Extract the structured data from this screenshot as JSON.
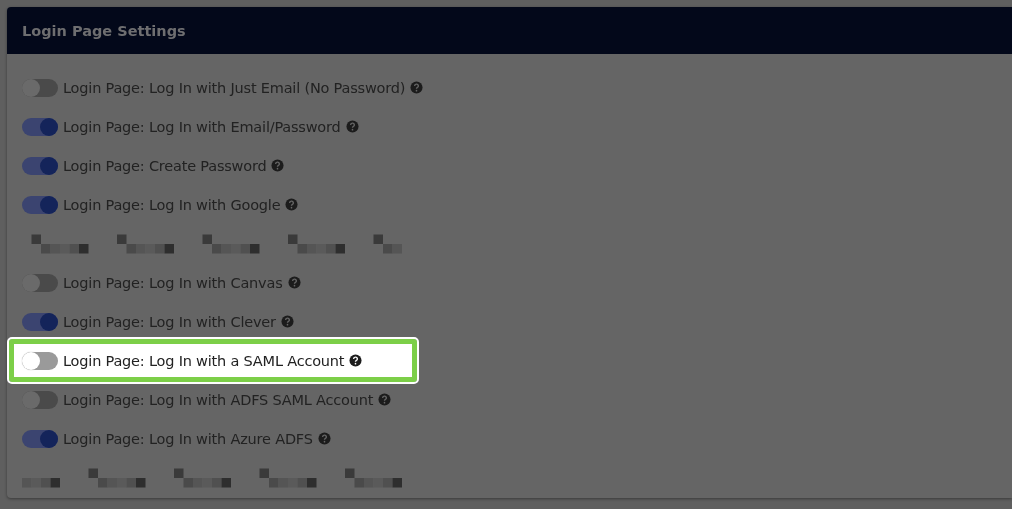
{
  "panel": {
    "title": "Login Page Settings"
  },
  "settings": [
    {
      "kind": "toggle",
      "label": "Login Page: Log In with Just Email (No Password)",
      "on": false,
      "highlighted": false
    },
    {
      "kind": "toggle",
      "label": "Login Page: Log In with Email/Password",
      "on": true,
      "highlighted": false
    },
    {
      "kind": "toggle",
      "label": "Login Page: Create Password",
      "on": true,
      "highlighted": false
    },
    {
      "kind": "toggle",
      "label": "Login Page: Log In with Google",
      "on": true,
      "highlighted": false
    },
    {
      "kind": "redacted"
    },
    {
      "kind": "toggle",
      "label": "Login Page: Log In with Canvas",
      "on": false,
      "highlighted": false
    },
    {
      "kind": "toggle",
      "label": "Login Page: Log In with Clever",
      "on": true,
      "highlighted": false
    },
    {
      "kind": "toggle",
      "label": "Login Page: Log In with a SAML Account",
      "on": false,
      "highlighted": true
    },
    {
      "kind": "toggle",
      "label": "Login Page: Log In with ADFS SAML Account",
      "on": false,
      "highlighted": false
    },
    {
      "kind": "toggle",
      "label": "Login Page: Log In with Azure ADFS",
      "on": true,
      "highlighted": false
    },
    {
      "kind": "redacted"
    }
  ]
}
